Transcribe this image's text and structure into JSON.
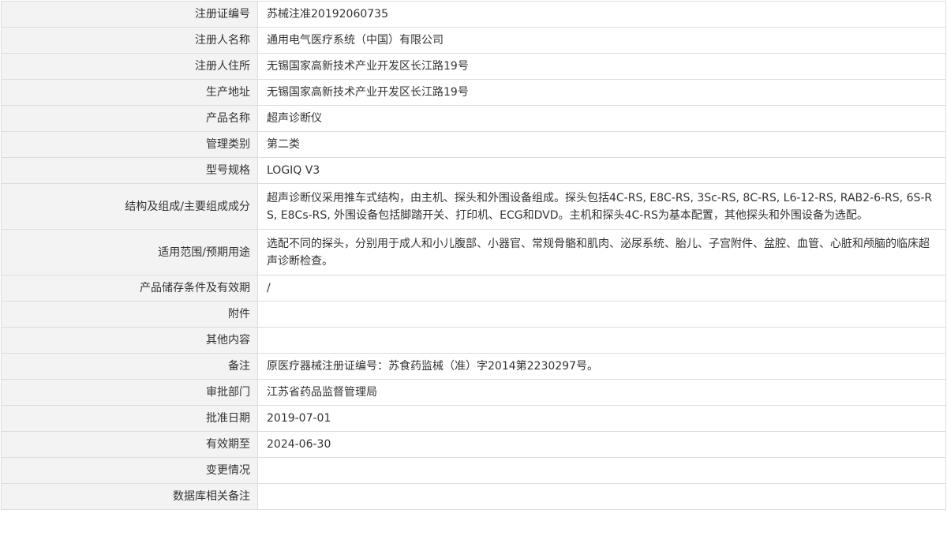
{
  "record": {
    "rows": [
      {
        "label": "注册证编号",
        "value": "苏械注准20192060735"
      },
      {
        "label": "注册人名称",
        "value": "通用电气医疗系统（中国）有限公司"
      },
      {
        "label": "注册人住所",
        "value": "无锡国家高新技术产业开发区长江路19号"
      },
      {
        "label": "生产地址",
        "value": "无锡国家高新技术产业开发区长江路19号"
      },
      {
        "label": "产品名称",
        "value": "超声诊断仪"
      },
      {
        "label": "管理类别",
        "value": "第二类"
      },
      {
        "label": "型号规格",
        "value": "LOGIQ V3"
      },
      {
        "label": "结构及组成/主要组成成分",
        "value": "超声诊断仪采用推车式结构，由主机、探头和外围设备组成。探头包括4C-RS, E8C-RS, 3Sc-RS, 8C-RS, L6-12-RS, RAB2-6-RS, 6S-RS, E8Cs-RS, 外围设备包括脚踏开关、打印机、ECG和DVD。主机和探头4C-RS为基本配置，其他探头和外围设备为选配。"
      },
      {
        "label": "适用范围/预期用途",
        "value": "选配不同的探头，分别用于成人和小儿腹部、小器官、常规骨骼和肌肉、泌尿系统、胎儿、子宫附件、盆腔、血管、心脏和颅脑的临床超声诊断检查。"
      },
      {
        "label": "产品储存条件及有效期",
        "value": "/"
      },
      {
        "label": "附件",
        "value": ""
      },
      {
        "label": "其他内容",
        "value": ""
      },
      {
        "label": "备注",
        "value": "原医疗器械注册证编号：苏食药监械（准）字2014第2230297号。"
      },
      {
        "label": "审批部门",
        "value": "江苏省药品监督管理局"
      },
      {
        "label": "批准日期",
        "value": "2019-07-01"
      },
      {
        "label": "有效期至",
        "value": "2024-06-30"
      },
      {
        "label": "变更情况",
        "value": ""
      },
      {
        "label": "数据库相关备注",
        "value": ""
      }
    ]
  }
}
